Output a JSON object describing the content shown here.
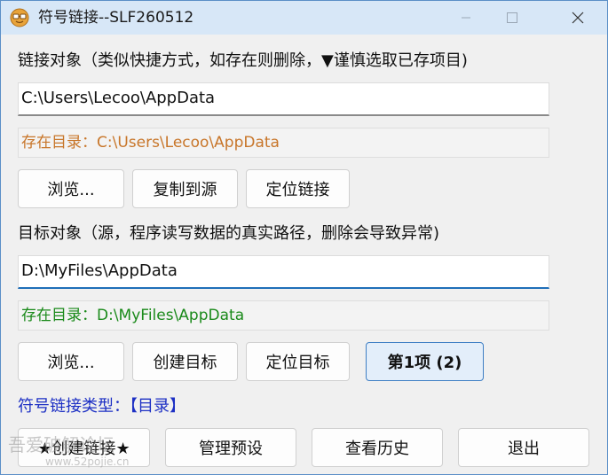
{
  "window": {
    "title": "符号链接--SLF260512",
    "minimize_label": "minimize",
    "maximize_label": "maximize",
    "close_label": "close"
  },
  "link": {
    "label": "链接对象（类似快捷方式，如存在则删除，▼谨慎选取已存项目)",
    "value": "C:\\Users\\Lecoo\\AppData",
    "status": "存在目录：C:\\Users\\Lecoo\\AppData",
    "status_color": "#c8762a",
    "browse_button": "浏览...",
    "copy_button": "复制到源",
    "locate_button": "定位链接"
  },
  "target": {
    "label": "目标对象（源，程序读写数据的真实路径，删除会导致异常)",
    "value": "D:\\MyFiles\\AppData",
    "status": "存在目录：D:\\MyFiles\\AppData",
    "status_color": "#1a8a1a",
    "browse_button": "浏览...",
    "create_button": "创建目标",
    "locate_button": "定位目标",
    "item_button": "第1项 (2)"
  },
  "link_type": {
    "text": "符号链接类型：【目录】",
    "color": "#1c2fc4"
  },
  "footer": {
    "create_link_button": "★创建链接★",
    "manage_presets_button": "管理预设",
    "view_history_button": "查看历史",
    "exit_button": "退出"
  },
  "watermark": {
    "line1": "吾爱破解论坛",
    "line2": "www.52pojie.cn"
  },
  "colors": {
    "titlebar": "#d7e7f7",
    "accent_border": "#3f7fc4",
    "accent_bg": "#e3eefa",
    "focus_underline": "#1f6fb8"
  },
  "icons": {
    "app": "app-icon",
    "minimize": "minimize-icon",
    "maximize": "maximize-icon",
    "close": "close-icon"
  }
}
